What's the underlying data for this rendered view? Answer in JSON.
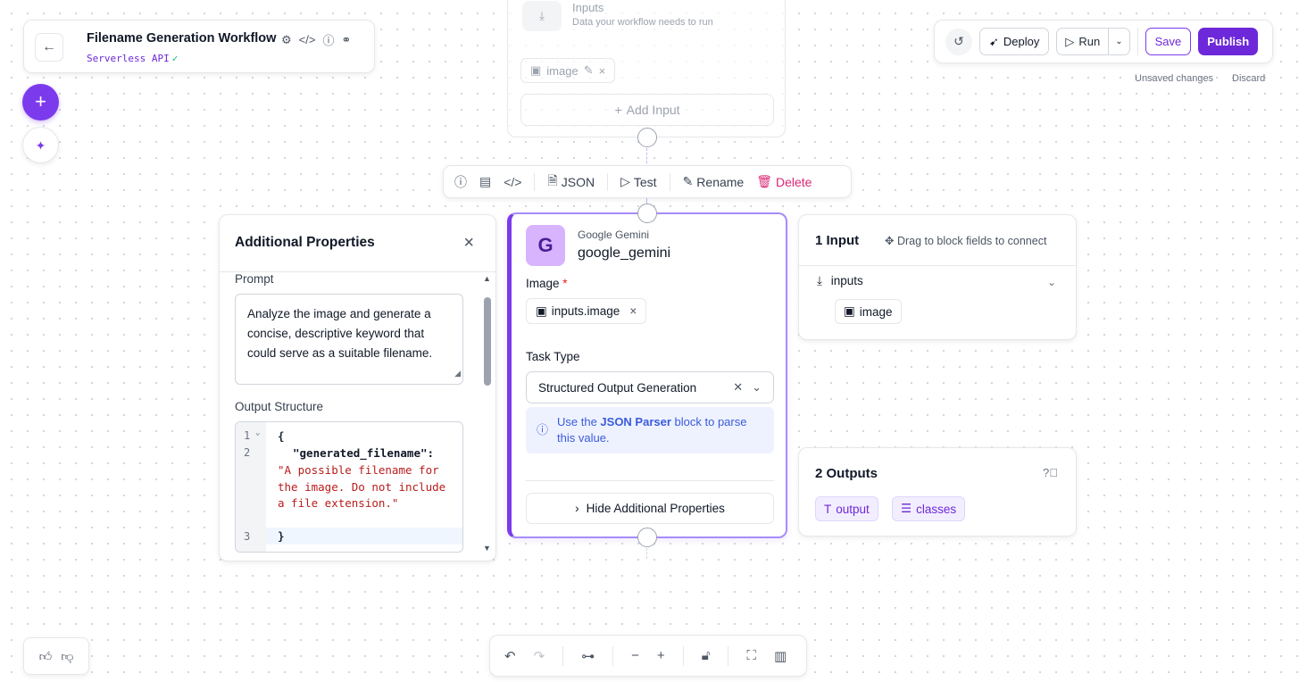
{
  "header": {
    "title": "Filename Generation Workflow",
    "subtitle": "Serverless API",
    "subtitle_check": "✓"
  },
  "toolbar": {
    "deploy_label": "Deploy",
    "run_label": "Run",
    "save_label": "Save",
    "publish_label": "Publish",
    "unsaved_label": "Unsaved changes",
    "discard_label": "Discard"
  },
  "inputs_block": {
    "title": "Inputs",
    "subtitle": "Data your workflow needs to run",
    "image_chip": "image",
    "add_input_label": "Add Input"
  },
  "node_toolbar": {
    "json_label": "JSON",
    "test_label": "Test",
    "rename_label": "Rename",
    "delete_label": "Delete"
  },
  "props_panel": {
    "title": "Additional Properties",
    "prompt_label": "Prompt",
    "prompt_value": "Analyze the image and generate a concise, descriptive keyword that could serve as a suitable filename.",
    "output_label": "Output Structure",
    "code": {
      "line1_num": "1",
      "line2_num": "2",
      "line3_num": "3",
      "open_brace": "{",
      "key": "\"generated_filename\":",
      "value": "\"A possible filename for the image. Do not include a file extension.\"",
      "close_brace": "}"
    }
  },
  "gemini_node": {
    "provider": "Google Gemini",
    "name": "google_gemini",
    "logo_letter": "G",
    "image_label": "Image",
    "required_mark": "*",
    "image_value": "inputs.image",
    "task_label": "Task Type",
    "task_value": "Structured Output Generation",
    "info_prefix": "Use the ",
    "info_bold": "JSON Parser",
    "info_suffix": " block to parse this value.",
    "hide_props_label": "Hide Additional Properties"
  },
  "input_card": {
    "count_label": "1 Input",
    "drag_hint": "Drag to block fields to connect",
    "group_label": "inputs",
    "image_chip": "image"
  },
  "outputs_card": {
    "count_label": "2 Outputs",
    "output_chip": "output",
    "classes_chip": "classes"
  },
  "colors": {
    "accent": "#6d28d9",
    "accent_light": "#7c3aed",
    "delete": "#db2777",
    "info_text": "#3b5bdb"
  }
}
